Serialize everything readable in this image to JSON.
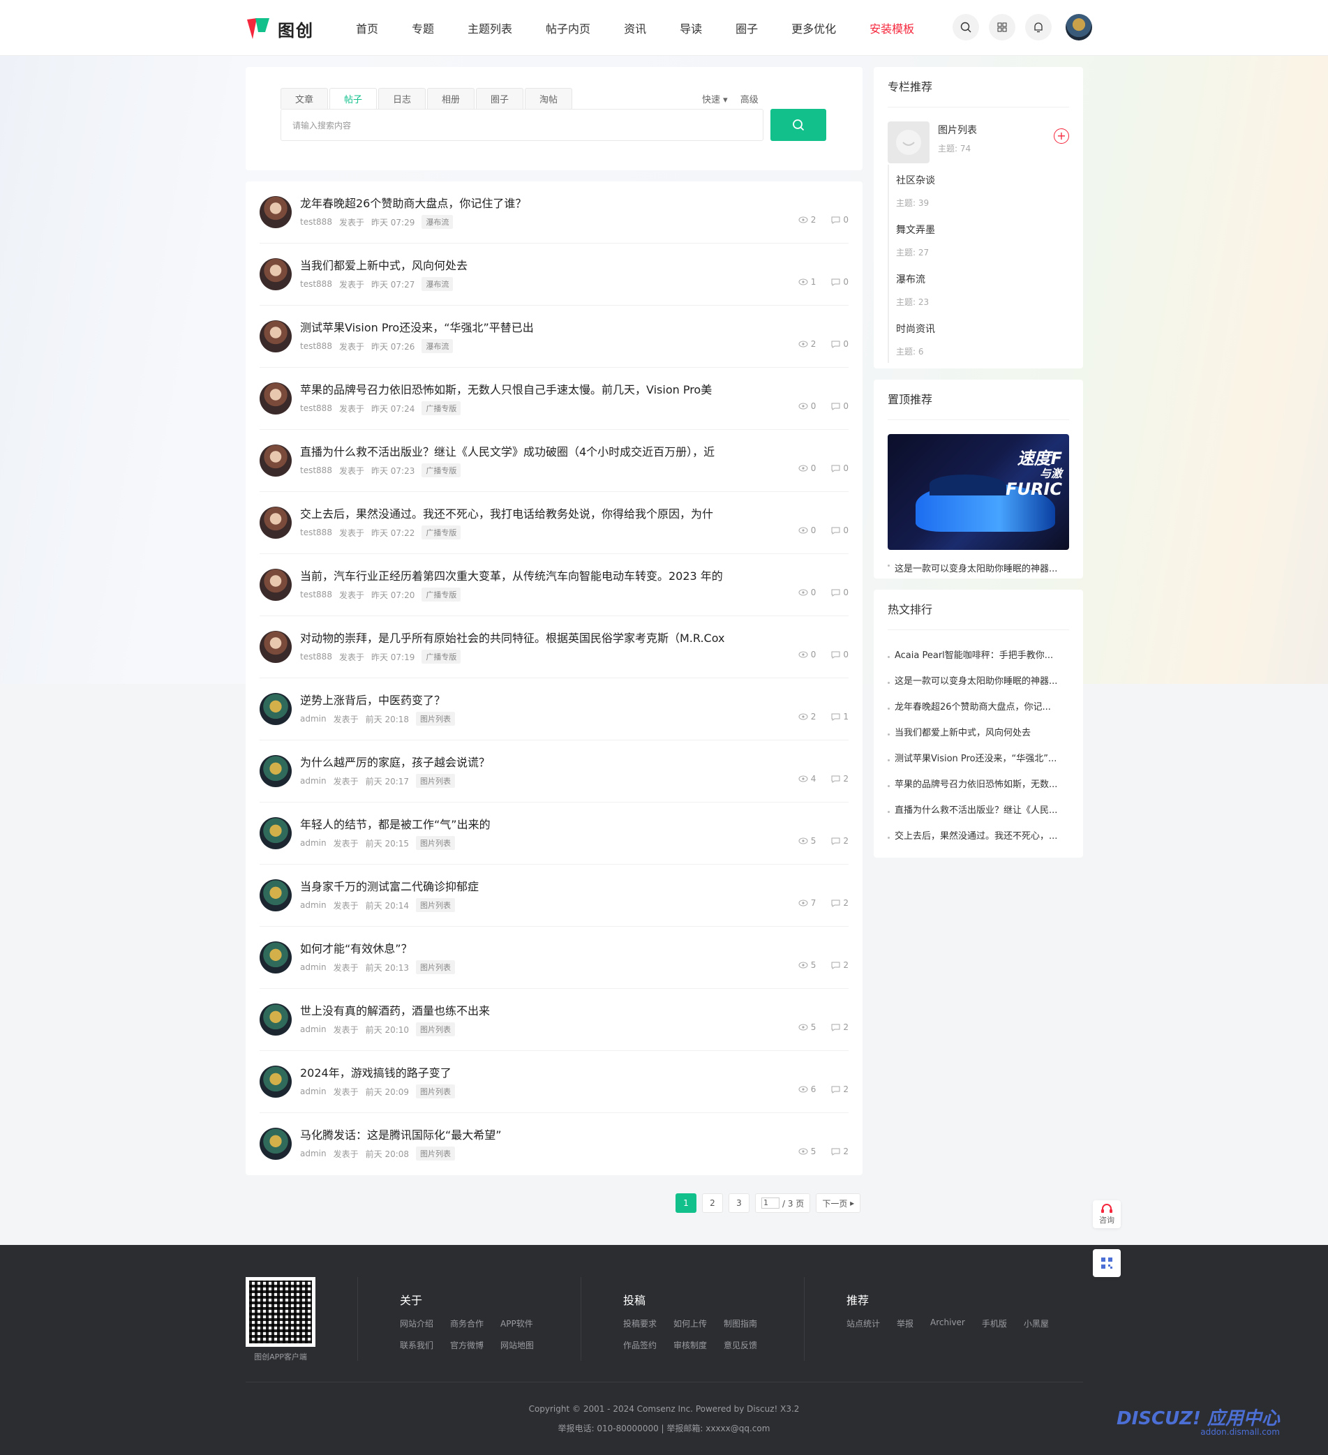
{
  "header": {
    "logo_text": "图创",
    "nav": [
      "首页",
      "专题",
      "主题列表",
      "帖子内页",
      "资讯",
      "导读",
      "圈子",
      "更多优化",
      "安装模板"
    ],
    "nav_highlight_index": 8,
    "icons": [
      "search-icon",
      "grid-icon",
      "bell-icon",
      "user-avatar"
    ]
  },
  "search": {
    "tabs": [
      "文章",
      "帖子",
      "日志",
      "相册",
      "圈子",
      "淘帖"
    ],
    "active_tab": 1,
    "options": {
      "quick": "快速",
      "advanced": "高级"
    },
    "placeholder": "请输入搜索内容",
    "button_icon": "search-icon"
  },
  "threads": [
    {
      "title": "龙年春晚超26个赞助商大盘点，你记住了谁？",
      "author": "test888",
      "verb": "发表于",
      "time": "昨天 07:29",
      "tag": "瀑布流",
      "views": "2",
      "replies": "0",
      "avatar": "av1"
    },
    {
      "title": "当我们都爱上新中式，风向何处去",
      "author": "test888",
      "verb": "发表于",
      "time": "昨天 07:27",
      "tag": "瀑布流",
      "views": "1",
      "replies": "0",
      "avatar": "av1"
    },
    {
      "title": "测试苹果Vision Pro还没来，“华强北”平替已出",
      "author": "test888",
      "verb": "发表于",
      "time": "昨天 07:26",
      "tag": "瀑布流",
      "views": "2",
      "replies": "0",
      "avatar": "av1"
    },
    {
      "title": "苹果的品牌号召力依旧恐怖如斯，无数人只恨自己手速太慢。前几天，Vision Pro美",
      "author": "test888",
      "verb": "发表于",
      "time": "昨天 07:24",
      "tag": "广播专版",
      "views": "0",
      "replies": "0",
      "avatar": "av1"
    },
    {
      "title": "直播为什么救不活出版业？继让《人民文学》成功破圈（4个小时成交近百万册），近",
      "author": "test888",
      "verb": "发表于",
      "time": "昨天 07:23",
      "tag": "广播专版",
      "views": "0",
      "replies": "0",
      "avatar": "av1"
    },
    {
      "title": "交上去后，果然没通过。我还不死心，我打电话给教务处说，你得给我个原因，为什",
      "author": "test888",
      "verb": "发表于",
      "time": "昨天 07:22",
      "tag": "广播专版",
      "views": "0",
      "replies": "0",
      "avatar": "av1"
    },
    {
      "title": "当前，汽车行业正经历着第四次重大变革，从传统汽车向智能电动车转变。2023 年的",
      "author": "test888",
      "verb": "发表于",
      "time": "昨天 07:20",
      "tag": "广播专版",
      "views": "0",
      "replies": "0",
      "avatar": "av1"
    },
    {
      "title": "对动物的崇拜，是几乎所有原始社会的共同特征。根据英国民俗学家考克斯（M.R.Cox",
      "author": "test888",
      "verb": "发表于",
      "time": "昨天 07:19",
      "tag": "广播专版",
      "views": "0",
      "replies": "0",
      "avatar": "av1"
    },
    {
      "title": "逆势上涨背后，中医药变了？",
      "author": "admin",
      "verb": "发表于",
      "time": "前天 20:18",
      "tag": "图片列表",
      "views": "2",
      "replies": "1",
      "avatar": "av2"
    },
    {
      "title": "为什么越严厉的家庭，孩子越会说谎？",
      "author": "admin",
      "verb": "发表于",
      "time": "前天 20:17",
      "tag": "图片列表",
      "views": "4",
      "replies": "2",
      "avatar": "av2"
    },
    {
      "title": "年轻人的结节，都是被工作“气”出来的",
      "author": "admin",
      "verb": "发表于",
      "time": "前天 20:15",
      "tag": "图片列表",
      "views": "5",
      "replies": "2",
      "avatar": "av2"
    },
    {
      "title": "当身家千万的测试富二代确诊抑郁症",
      "author": "admin",
      "verb": "发表于",
      "time": "前天 20:14",
      "tag": "图片列表",
      "views": "7",
      "replies": "2",
      "avatar": "av2"
    },
    {
      "title": "如何才能“有效休息”？",
      "author": "admin",
      "verb": "发表于",
      "time": "前天 20:13",
      "tag": "图片列表",
      "views": "5",
      "replies": "2",
      "avatar": "av2"
    },
    {
      "title": "世上没有真的解酒药，酒量也练不出来",
      "author": "admin",
      "verb": "发表于",
      "time": "前天 20:10",
      "tag": "图片列表",
      "views": "5",
      "replies": "2",
      "avatar": "av2"
    },
    {
      "title": "2024年，游戏搞钱的路子变了",
      "author": "admin",
      "verb": "发表于",
      "time": "前天 20:09",
      "tag": "图片列表",
      "views": "6",
      "replies": "2",
      "avatar": "av2"
    },
    {
      "title": "马化腾发话：这是腾讯国际化“最大希望”",
      "author": "admin",
      "verb": "发表于",
      "time": "前天 20:08",
      "tag": "图片列表",
      "views": "5",
      "replies": "2",
      "avatar": "av2"
    }
  ],
  "pager": {
    "pages": [
      "1",
      "2",
      "3"
    ],
    "current": "1",
    "input_value": "1",
    "total_text": "/ 3 页",
    "next": "下一页"
  },
  "sidebar": {
    "column_title": "专栏推荐",
    "column_top": {
      "name": "图片列表",
      "meta": "主题: 74"
    },
    "columns": [
      {
        "name": "社区杂谈",
        "meta": "主题: 39"
      },
      {
        "name": "舞文弄墨",
        "meta": "主题: 27"
      },
      {
        "name": "瀑布流",
        "meta": "主题: 23"
      },
      {
        "name": "时尚资讯",
        "meta": "主题: 6"
      }
    ],
    "pinned_title": "置顶推荐",
    "pinned_caption": "这是一款可以变身太阳助你睡眠的神器...",
    "pinned_brand_lines": [
      "速度F",
      "与激",
      "FURIC"
    ],
    "hot_title": "热文排行",
    "hot_items": [
      "Acaia Pearl智能咖啡秤：手把手教你...",
      "这是一款可以变身太阳助你睡眠的神器...",
      "龙年春晚超26个赞助商大盘点，你记...",
      "当我们都爱上新中式，风向何处去",
      "测试苹果Vision Pro还没来，“华强北”...",
      "苹果的品牌号召力依旧恐怖如斯，无数...",
      "直播为什么救不活出版业？继让《人民...",
      "交上去后，果然没通过。我还不死心，..."
    ]
  },
  "floats": {
    "consult": "咨询"
  },
  "footer": {
    "qr_caption": "图创APP客户端",
    "cols": [
      {
        "title": "关于",
        "links": [
          "网站介绍",
          "商务合作",
          "APP软件",
          "联系我们",
          "官方微博",
          "网站地图"
        ]
      },
      {
        "title": "投稿",
        "links": [
          "投稿要求",
          "如何上传",
          "制图指南",
          "作品签约",
          "审核制度",
          "意见反馈"
        ]
      },
      {
        "title": "推荐",
        "links": [
          "站点统计",
          "举报",
          "Archiver",
          "手机版",
          "小黑屋"
        ]
      }
    ],
    "copyright": "Copyright © 2001 - 2024 Comsenz Inc. Powered by Discuz! X3.2",
    "report": "举报电话: 010-80000000 | 举报邮箱: xxxxx@qq.com",
    "watermark": "DISCUZ! 应用中心",
    "watermark_url": "addon.dismall.com"
  },
  "colors": {
    "accent": "#12c08c",
    "highlight": "#f5273c",
    "footer_bg": "#2b2d31"
  }
}
